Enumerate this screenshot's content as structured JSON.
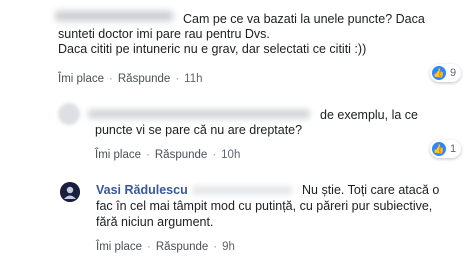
{
  "comments": [
    {
      "author": "",
      "text_lines": [
        "Cam pe ce va bazati la unele puncte? Daca",
        "sunteti doctor imi pare rau pentru Dvs.",
        "Daca cititi pe intuneric nu e grav, dar selectati ce cititi :))"
      ],
      "like_label": "Îmi place",
      "reply_label": "Răspunde",
      "time": "11h",
      "reaction_count": "9"
    },
    {
      "author": "",
      "text_lines": [
        "de exemplu, la ce",
        "puncte vi se pare că nu are dreptate?"
      ],
      "like_label": "Îmi place",
      "reply_label": "Răspunde",
      "time": "10h",
      "reaction_count": "1"
    },
    {
      "author": "Vasi Rădulescu",
      "text_lines": [
        "Nu știe. Toți care atacă o",
        "fac în cel mai tâmpit mod cu putință, cu păreri pur subiective,",
        "fără niciun argument."
      ],
      "like_label": "Îmi place",
      "reply_label": "Răspunde",
      "time": "9h"
    }
  ],
  "colors": {
    "link": "#385898",
    "like_badge": "#2d88ff",
    "meta": "#606770"
  },
  "icons": [
    "thumbs-up-icon",
    "avatar-icon"
  ]
}
